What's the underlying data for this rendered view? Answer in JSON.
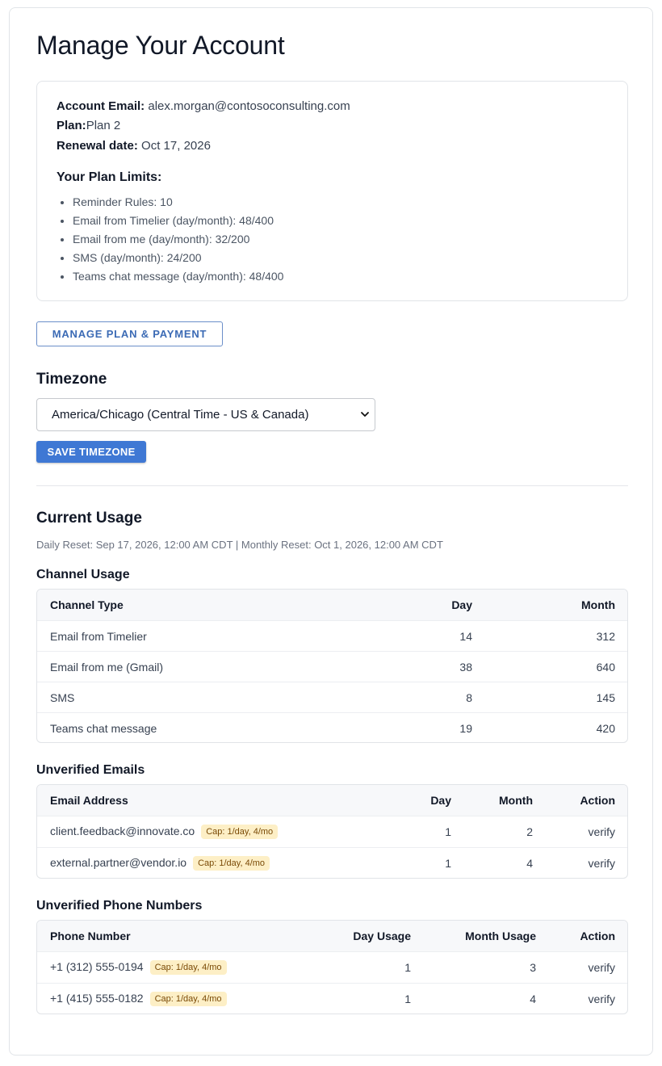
{
  "page": {
    "title": "Manage Your Account"
  },
  "account": {
    "email_label": "Account Email:",
    "email": "alex.morgan@contosoconsulting.com",
    "plan_label": "Plan:",
    "plan": "Plan 2",
    "renewal_label": "Renewal date:",
    "renewal_date": "Oct 17, 2026",
    "limits_title": "Your Plan Limits:",
    "limits": [
      "Reminder Rules: 10",
      "Email from Timelier (day/month): 48/400",
      "Email from me (day/month): 32/200",
      "SMS (day/month): 24/200",
      "Teams chat message (day/month): 48/400"
    ]
  },
  "manage_button": "MANAGE PLAN & PAYMENT",
  "timezone": {
    "title": "Timezone",
    "selected": "America/Chicago (Central Time - US & Canada)",
    "save_button": "SAVE TIMEZONE"
  },
  "usage": {
    "title": "Current Usage",
    "reset_line": "Daily Reset: Sep 17, 2026, 12:00 AM CDT  |  Monthly Reset: Oct 1, 2026, 12:00 AM CDT",
    "channel": {
      "title": "Channel Usage",
      "headers": [
        "Channel Type",
        "Day",
        "Month"
      ],
      "rows": [
        {
          "name": "Email from Timelier",
          "day": "14",
          "month": "312"
        },
        {
          "name": "Email from me (Gmail)",
          "day": "38",
          "month": "640"
        },
        {
          "name": "SMS",
          "day": "8",
          "month": "145"
        },
        {
          "name": "Teams chat message",
          "day": "19",
          "month": "420"
        }
      ]
    },
    "emails": {
      "title": "Unverified Emails",
      "headers": [
        "Email Address",
        "Day",
        "Month",
        "Action"
      ],
      "rows": [
        {
          "address": "client.feedback@innovate.co",
          "cap": "Cap: 1/day, 4/mo",
          "day": "1",
          "month": "2",
          "action": "verify"
        },
        {
          "address": "external.partner@vendor.io",
          "cap": "Cap: 1/day, 4/mo",
          "day": "1",
          "month": "4",
          "action": "verify"
        }
      ]
    },
    "phones": {
      "title": "Unverified Phone Numbers",
      "headers": [
        "Phone Number",
        "Day Usage",
        "Month Usage",
        "Action"
      ],
      "rows": [
        {
          "number": "+1 (312) 555-0194",
          "cap": "Cap: 1/day, 4/mo",
          "day": "1",
          "month": "3",
          "action": "verify"
        },
        {
          "number": "+1 (415) 555-0182",
          "cap": "Cap: 1/day, 4/mo",
          "day": "1",
          "month": "4",
          "action": "verify"
        }
      ]
    }
  }
}
